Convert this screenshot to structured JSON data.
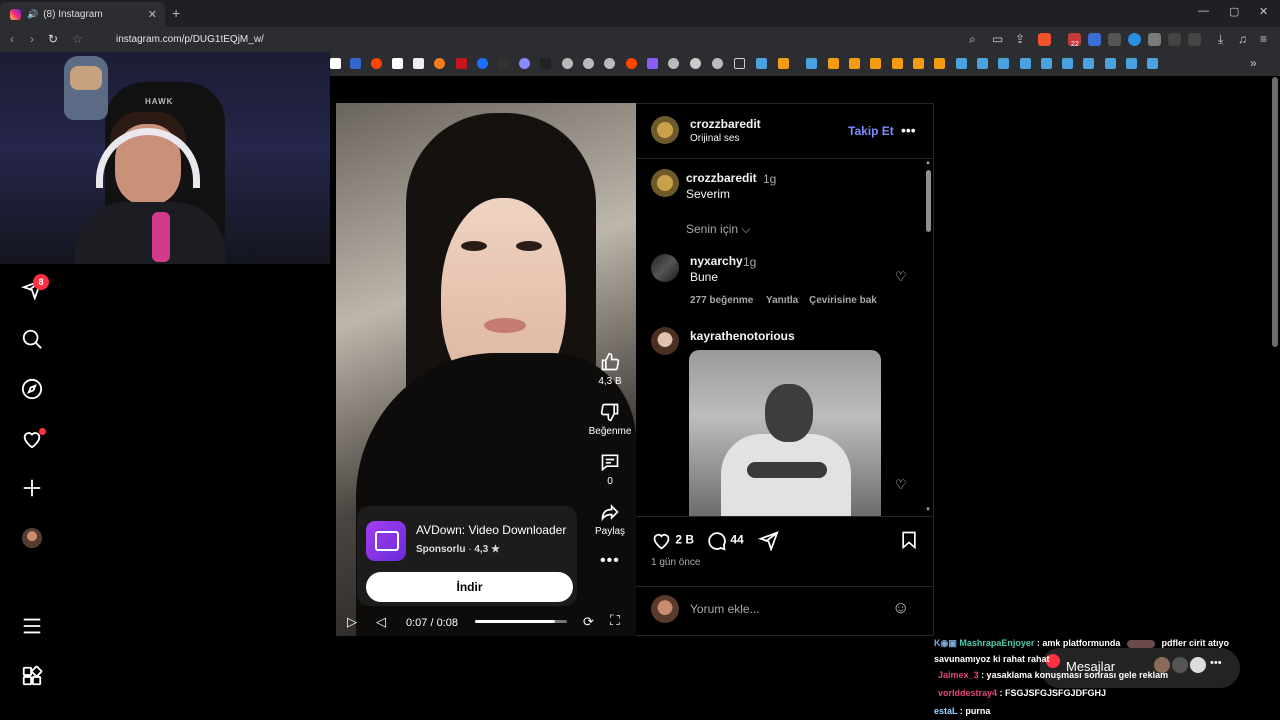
{
  "browser": {
    "tab_title": "(8) Instagram",
    "url": "instagram.com/p/DUG1tEQjM_w/",
    "ext_badge": "22"
  },
  "sidebar": {
    "notification_count": "8"
  },
  "webcam": {
    "chair_brand": "HAWK"
  },
  "post": {
    "author": "crozzbaredit",
    "audio": "Orijinal ses",
    "follow_label": "Takip Et",
    "likes": "2 B",
    "comments_count": "44",
    "time_ago": "1 gün önce",
    "comment_placeholder": "Yorum ekle..."
  },
  "video": {
    "like_count": "4,3 B",
    "dislike_label": "Beğenme",
    "comment_count": "0",
    "share_label": "Paylaş",
    "time": "0:07 / 0:08",
    "progress": 0.87
  },
  "ad": {
    "title": "AVDown: Video Downloader",
    "sponsored": "Sponsorlu",
    "rating": "4,3 ★",
    "cta": "İndir"
  },
  "comments": [
    {
      "user": "crozzbaredit",
      "time": "1g",
      "text": "Severim"
    },
    {
      "user": "nyxarchy",
      "time": "1g",
      "text": "Bune",
      "likes": "277 beğenme",
      "reply": "Yanıtla",
      "translate": "Çevirisine bak"
    },
    {
      "user": "kayrathenotorious"
    }
  ],
  "for_you": "Senin için",
  "chat": [
    {
      "user": "MashrapaEnjoyer",
      "text": ": amk platformunda",
      "text2": "pdfler cirit atıyo",
      "color": "#4ec9b0"
    },
    {
      "user": "",
      "text": "savunamıyoz ki rahat rahat",
      "color": "#ffffff"
    },
    {
      "user": "Jaimex_3",
      "text": ": yasaklama konuşması sonrası gele reklam",
      "color": "#e0457b"
    },
    {
      "user": "vorlddestray4",
      "text": ": FSGJSFGJSFGJDFGHJ",
      "color": "#e0457b"
    },
    {
      "user": "estaL",
      "text": ": purna",
      "color": "#9ad0ff"
    }
  ],
  "messages_label": "Mesajlar",
  "colors": {
    "accent_link": "#7d8cff",
    "notification": "#ff3040"
  }
}
